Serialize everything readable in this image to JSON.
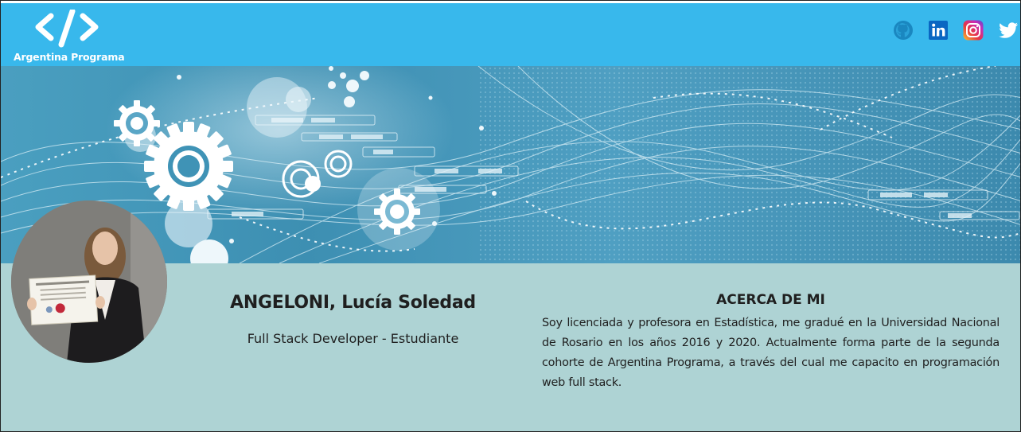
{
  "header": {
    "logo_text": "Argentina Programa",
    "logo_icon": "code-brackets-icon",
    "background": "#38b8ec",
    "socials": [
      {
        "name": "github",
        "icon": "github-icon"
      },
      {
        "name": "linkedin",
        "icon": "linkedin-icon"
      },
      {
        "name": "instagram",
        "icon": "instagram-icon"
      },
      {
        "name": "twitter",
        "icon": "twitter-icon"
      }
    ]
  },
  "banner": {
    "image": "technology-gears-network-banner"
  },
  "profile": {
    "avatar": "profile-photo",
    "name": "ANGELONI, Lucía Soledad",
    "role": "Full Stack Developer - Estudiante",
    "background": "#aed3d4"
  },
  "about": {
    "title": "ACERCA DE MI",
    "text": "Soy licenciada y profesora en Estadística, me gradué en la Universidad Nacional de Rosario en los años 2016 y 2020. Actualmente forma parte de la segunda cohorte de Argentina Programa, a través del cual me capacito en programación web full stack."
  }
}
